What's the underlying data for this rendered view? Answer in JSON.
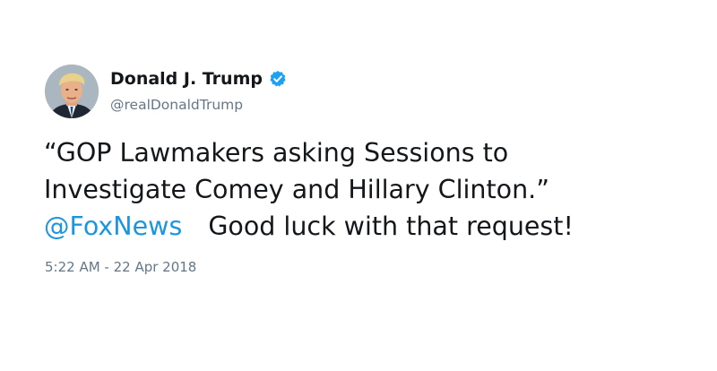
{
  "author": {
    "display_name": "Donald J. Trump",
    "handle": "@realDonaldTrump",
    "verified": true,
    "verified_icon": "verified-badge-icon",
    "avatar": "profile-photo"
  },
  "tweet": {
    "line1": "“GOP Lawmakers asking Sessions to",
    "line2": "Investigate Comey and Hillary Clinton.”",
    "mention": "@FoxNews",
    "line3_rest": "Good luck with that request!"
  },
  "meta": {
    "timestamp": "5:22 AM - 22 Apr 2018"
  },
  "colors": {
    "text": "#14171a",
    "secondary": "#657786",
    "link": "#1b95e0",
    "verified": "#1da1f2"
  }
}
